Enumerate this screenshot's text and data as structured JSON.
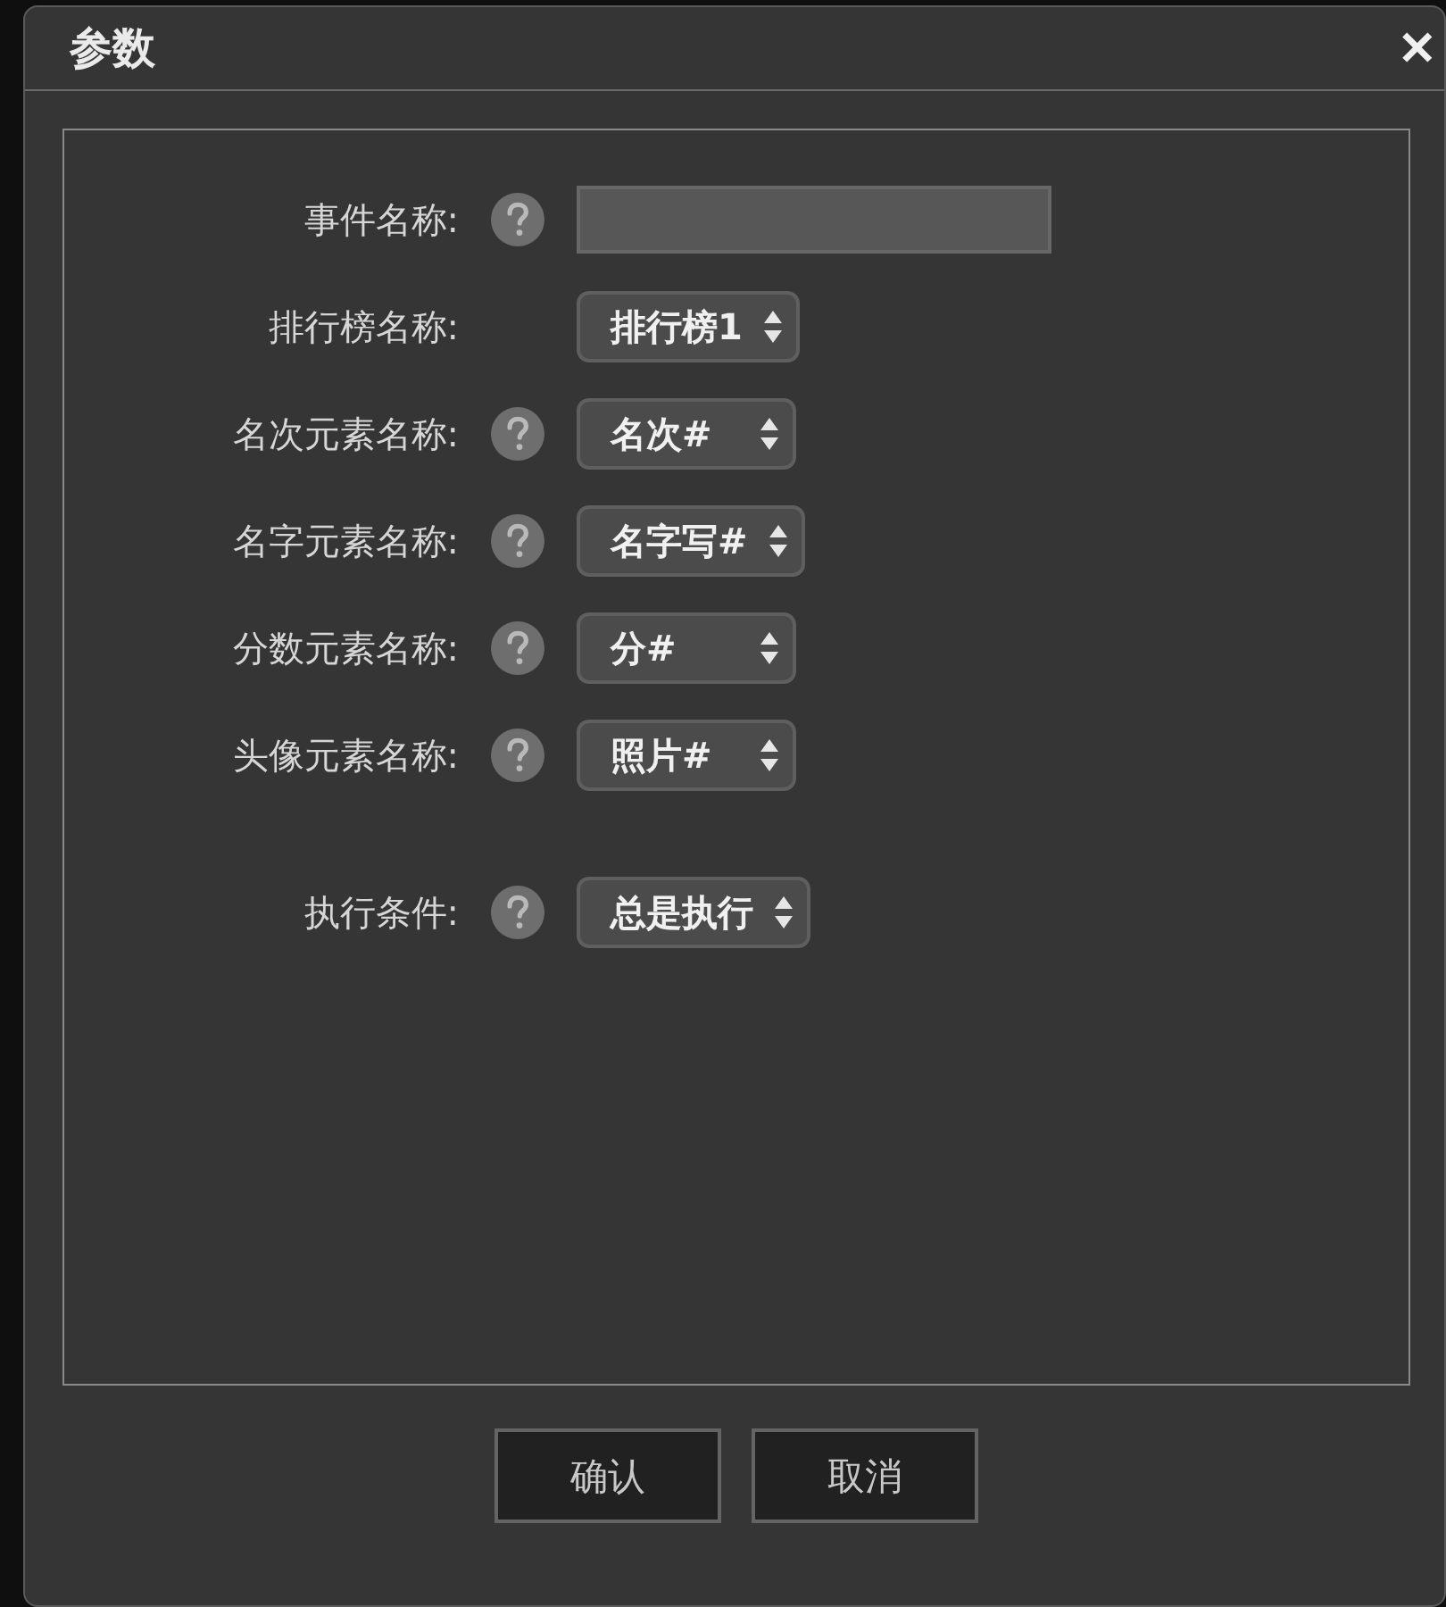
{
  "window": {
    "title": "参数",
    "close": "✕"
  },
  "sections": [
    {
      "fields": [
        {
          "label": "事件名称:",
          "help": true,
          "kind": "text"
        },
        {
          "label": "排行榜名称:",
          "help": false,
          "kind": "select",
          "value": "排行榜1"
        },
        {
          "label": "名次元素名称:",
          "help": true,
          "kind": "select",
          "value": "名次#"
        },
        {
          "label": "名字元素名称:",
          "help": true,
          "kind": "select",
          "value": "名字写#"
        },
        {
          "label": "分数元素名称:",
          "help": true,
          "kind": "select",
          "value": "分#"
        },
        {
          "label": "头像元素名称:",
          "help": true,
          "kind": "select",
          "value": "照片#"
        }
      ]
    },
    {
      "fields": [
        {
          "label": "执行条件:",
          "help": true,
          "kind": "select",
          "value": "总是执行"
        }
      ]
    }
  ],
  "buttons": [
    "确认",
    "取消"
  ]
}
